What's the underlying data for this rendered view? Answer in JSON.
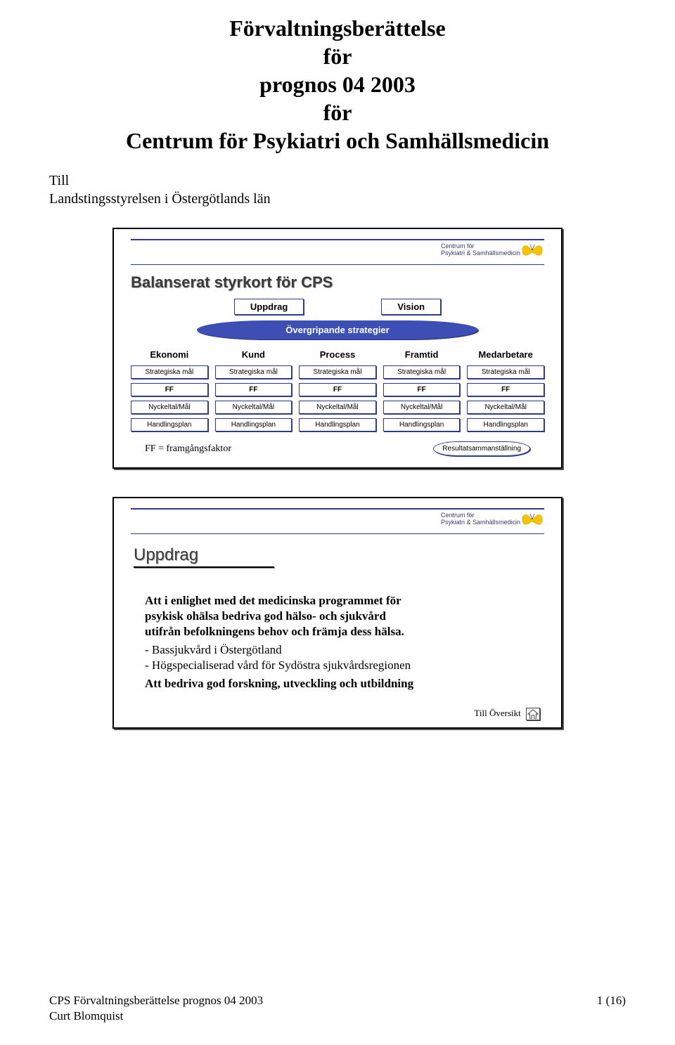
{
  "title": {
    "line1": "Förvaltningsberättelse",
    "line2": "för",
    "line3": "prognos 04 2003",
    "line4": "för",
    "line5": "Centrum för Psykiatri och Samhällsmedicin"
  },
  "addressee": {
    "line1": "Till",
    "line2": "Landstingsstyrelsen i Östergötlands län"
  },
  "org": {
    "line1": "Centrum för",
    "line2": "Psykiatri & Samhällsmedicin"
  },
  "slide1": {
    "title": "Balanserat styrkort för CPS",
    "uppdrag": "Uppdrag",
    "vision": "Vision",
    "strategier": "Övergripande strategier",
    "cols": [
      "Ekonomi",
      "Kund",
      "Process",
      "Framtid",
      "Medarbetare"
    ],
    "row_strategiska": "Strategiska mål",
    "row_ff": "FF",
    "row_nyckeltal": "Nyckeltal/Mål",
    "row_handlingsplan": "Handlingsplan",
    "ff_legend": "FF = framgångsfaktor",
    "result": "Resultatsammanställning"
  },
  "slide2": {
    "title": "Uppdrag",
    "p1a": "Att i enlighet med det medicinska programmet för",
    "p1b": "psykisk ohälsa bedriva god hälso- och sjukvård",
    "p1c": "utifrån befolkningens behov och främja dess hälsa.",
    "b1": "- Bassjukvård i Östergötland",
    "b2": "- Högspecialiserad vård för Sydöstra sjukvårdsregionen",
    "p2": "Att bedriva god forskning, utveckling och utbildning",
    "till": "Till Översikt"
  },
  "footer": {
    "l1": "CPS Förvaltningsberättelse prognos 04 2003",
    "l2": "Curt Blomquist",
    "page": "1 (16)"
  }
}
